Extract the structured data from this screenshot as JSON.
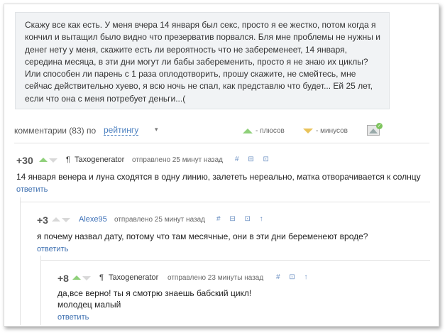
{
  "post": {
    "text": "Скажу все как есть. У меня вчера 14 января был секс, просто я ее жестко, потом когда я кончил и вытащил было видно что презерватив порвался. Бля мне проблемы не нужны и денег нету у меня, скажите есть ли вероятность что не забеременеет, 14 января, середина месяца, в эти дни могут ли бабы забеременить, просто я не знаю их циклы? Или способен ли парень с 1 раза оплодотворить, прошу скажите, не смейтесь, мне сейчас действительно хуево, я всю ночь не спал, как представлю что будет... Ей 25 лет, если что она с меня потребует деньги...("
  },
  "comments_bar": {
    "count_label": "комментарии (83) по",
    "sort_label": "рейтингу",
    "sort_arrow": "▾",
    "pluses_label": "- плюсов",
    "minuses_label": "- минусов",
    "image_toggle_icon": "image-icon"
  },
  "comments": [
    {
      "score": "+30",
      "author": "Taxogenerator",
      "time": "отправлено 25 минут назад",
      "actions": "# ⊟ ⊡",
      "text": "14 января венера и луна сходятся в одну линию, залететь нереально, матка отворачивается к солнцу",
      "reply_label": "ответить"
    },
    {
      "score": "+3",
      "author": "Alexe95",
      "time": "отправлено 25 минут назад",
      "actions": "# ⊟ ⊡ ↑",
      "text": "я почему назвал дату, потому что там месячные, они в эти дни беременеют вроде?",
      "reply_label": "ответить"
    },
    {
      "score": "+8",
      "author": "Taxogenerator",
      "time": "отправлено 23 минуты назад",
      "actions": "# ⊡ ↑",
      "text_line1": "да,все верно! ты я смотрю знаешь бабский цикл!",
      "text_line2": "молодец малый",
      "reply_label": "ответить"
    }
  ],
  "colors": {
    "link": "#3d6fb0",
    "vote_up": "#8fd07a",
    "vote_down": "#e9c35a",
    "post_bg": "#f1f3f5"
  }
}
